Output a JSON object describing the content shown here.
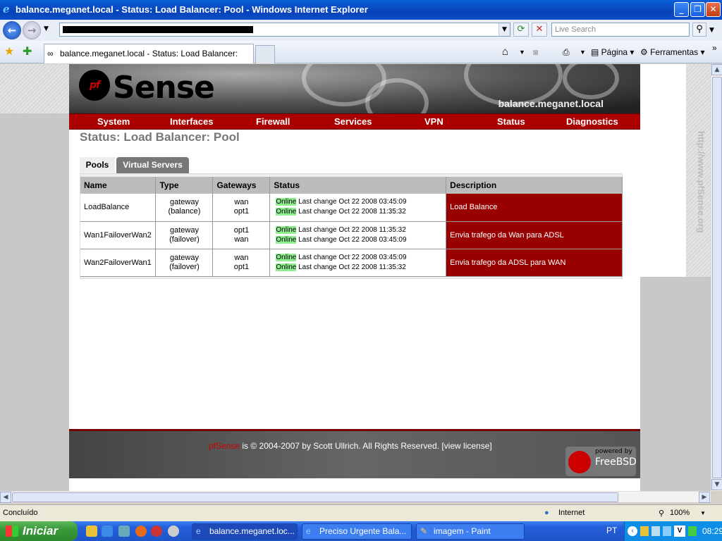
{
  "window": {
    "title": "balance.meganet.local - Status: Load Balancer: Pool - Windows Internet Explorer",
    "min": "_",
    "max": "❐",
    "close": "✕"
  },
  "toolbar": {
    "search_placeholder": "Live Search",
    "tab_title": "balance.meganet.local - Status: Load Balancer: Pool",
    "page_label": "Página",
    "tools_label": "Ferramentas",
    "more": "»"
  },
  "site": {
    "logo_text": "Sense",
    "hostname": "balance.meganet.local",
    "vertical_url": "http://www.pfSense.org",
    "nav": [
      "System",
      "Interfaces",
      "Firewall",
      "Services",
      "VPN",
      "Status",
      "Diagnostics"
    ],
    "page_title": "Status: Load Balancer: Pool",
    "tabs": [
      "Pools",
      "Virtual Servers"
    ],
    "columns": [
      "Name",
      "Type",
      "Gateways",
      "Status",
      "Description"
    ],
    "rows": [
      {
        "name": "LoadBalance",
        "type1": "gateway",
        "type2": "(balance)",
        "gw1": "wan",
        "gw2": "opt1",
        "st1_tag": "Online",
        "st1": " Last change Oct 22 2008 03:45:09",
        "st2_tag": "Online",
        "st2": " Last change Oct 22 2008 11:35:32",
        "desc": "Load Balance"
      },
      {
        "name": "Wan1FailoverWan2",
        "type1": "gateway",
        "type2": "(failover)",
        "gw1": "opt1",
        "gw2": "wan",
        "st1_tag": "Online",
        "st1": " Last change Oct 22 2008 11:35:32",
        "st2_tag": "Online",
        "st2": " Last change Oct 22 2008 03:45:09",
        "desc": "Envia trafego da Wan para ADSL"
      },
      {
        "name": "Wan2FailoverWan1",
        "type1": "gateway",
        "type2": "(failover)",
        "gw1": "wan",
        "gw2": "opt1",
        "st1_tag": "Online",
        "st1": " Last change Oct 22 2008 03:45:09",
        "st2_tag": "Online",
        "st2": " Last change Oct 22 2008 11:35:32",
        "desc": "Envia trafego da ADSL para WAN"
      }
    ],
    "footer_brand": "pfSense",
    "footer_text": " is © 2004-2007 by Scott Ullrich. All Rights Reserved. [view license]",
    "powered_by": "powered by",
    "freebsd": "FreeBSD"
  },
  "statusbar": {
    "left": "Concluído",
    "zone": "Internet",
    "zoom": "100%"
  },
  "taskbar": {
    "start": "Iniciar",
    "tasks": [
      "balance.meganet.loc...",
      "Preciso Urgente Bala...",
      "imagem - Paint"
    ],
    "lang": "PT",
    "time": "08:29"
  },
  "colors": {
    "accent": "#990000",
    "online": "#90ee90"
  }
}
